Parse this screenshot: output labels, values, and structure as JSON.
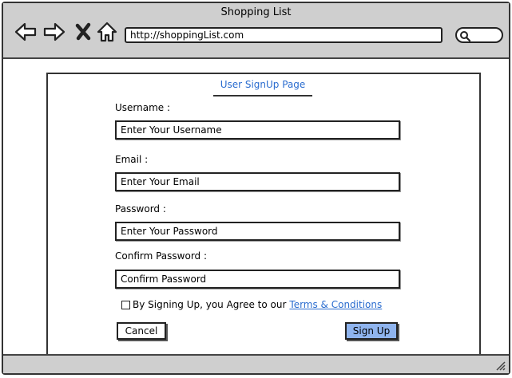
{
  "window": {
    "title": "Shopping List"
  },
  "browser": {
    "url": "http://shoppingList.com",
    "icons": [
      "back-arrow-icon",
      "forward-arrow-icon",
      "close-x-icon",
      "home-icon",
      "search-icon"
    ]
  },
  "form": {
    "title": "User SignUp Page",
    "fields": [
      {
        "label": "Username :",
        "placeholder": "Enter Your Username"
      },
      {
        "label": "Email :",
        "placeholder": "Enter Your Email"
      },
      {
        "label": "Password :",
        "placeholder": "Enter Your Password"
      },
      {
        "label": "Confirm Password :",
        "placeholder": "Confirm Password"
      }
    ],
    "agreement": {
      "text": "By Signing Up, you Agree to our",
      "link": "Terms & Conditions",
      "checked": false
    },
    "cancel_label": "Cancel",
    "signup_label": "Sign Up"
  },
  "colors": {
    "accent": "#2a6ccf",
    "primary_button": "#8fb4ee",
    "chrome": "#cfcfcf"
  }
}
